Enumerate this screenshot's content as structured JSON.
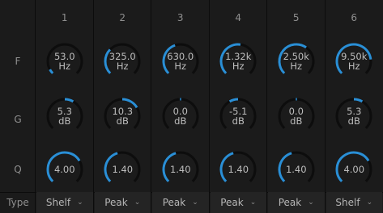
{
  "row_labels": {
    "freq": "F",
    "gain": "G",
    "q": "Q",
    "type": "Type"
  },
  "colors": {
    "accent": "#2a8fd6",
    "track": "#0d0d0d",
    "background": "#1b1b1b"
  },
  "bands": [
    {
      "number": "1",
      "freq_value": "53.0",
      "freq_unit": "Hz",
      "freq_level": 0.06,
      "gain_value": "5.3",
      "gain_unit": "dB",
      "gain_level": 0.61,
      "q_value": "4.00",
      "q_level": 0.72,
      "type": "Shelf"
    },
    {
      "number": "2",
      "freq_value": "325.0",
      "freq_unit": "Hz",
      "freq_level": 0.33,
      "gain_value": "10.3",
      "gain_unit": "dB",
      "gain_level": 0.72,
      "q_value": "1.40",
      "q_level": 0.44,
      "type": "Peak"
    },
    {
      "number": "3",
      "freq_value": "630.0",
      "freq_unit": "Hz",
      "freq_level": 0.43,
      "gain_value": "0.0",
      "gain_unit": "dB",
      "gain_level": 0.5,
      "q_value": "1.40",
      "q_level": 0.44,
      "type": "Peak"
    },
    {
      "number": "4",
      "freq_value": "1.32k",
      "freq_unit": "Hz",
      "freq_level": 0.53,
      "gain_value": "-5.1",
      "gain_unit": "dB",
      "gain_level": 0.39,
      "q_value": "1.40",
      "q_level": 0.44,
      "type": "Peak"
    },
    {
      "number": "5",
      "freq_value": "2.50k",
      "freq_unit": "Hz",
      "freq_level": 0.63,
      "gain_value": "0.0",
      "gain_unit": "dB",
      "gain_level": 0.5,
      "q_value": "1.40",
      "q_level": 0.44,
      "type": "Peak"
    },
    {
      "number": "6",
      "freq_value": "9.50k",
      "freq_unit": "Hz",
      "freq_level": 0.81,
      "gain_value": "5.3",
      "gain_unit": "dB",
      "gain_level": 0.61,
      "q_value": "4.00",
      "q_level": 0.72,
      "type": "Shelf"
    }
  ]
}
